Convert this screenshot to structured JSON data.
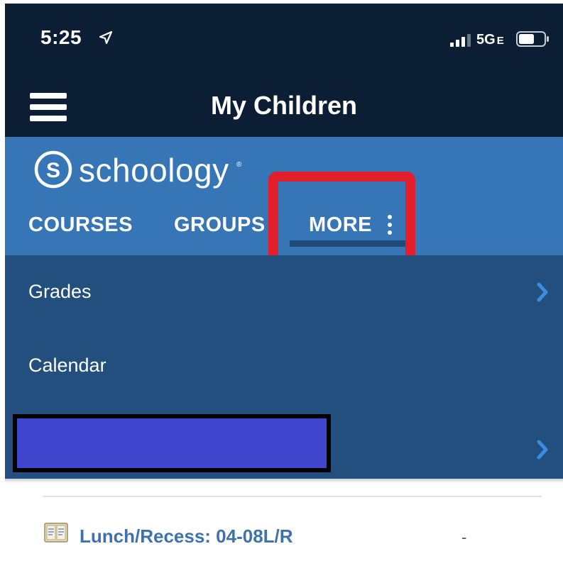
{
  "status_bar": {
    "time": "5:25",
    "network": "5G",
    "network_suffix": "E"
  },
  "title_bar": {
    "title": "My Children"
  },
  "brand": {
    "name": "schoology",
    "registered_mark": "®",
    "logo_letter": "S"
  },
  "tabs": [
    {
      "label": "COURSES"
    },
    {
      "label": "GROUPS"
    },
    {
      "label": "MORE"
    }
  ],
  "more_menu": {
    "items": [
      {
        "label": "Grades"
      },
      {
        "label": "Calendar"
      }
    ]
  },
  "course_list": [
    {
      "title": "Lunch/Recess: 04-08L/R",
      "grade": "-"
    }
  ],
  "colors": {
    "status_bg": "#0b1e33",
    "brand_blue": "#3776b6",
    "menu_bg": "#224f7d",
    "highlight_red": "#e21e2a",
    "redaction_blue": "#3f45cc",
    "link_blue": "#3f72ad"
  },
  "icons": {
    "location": "location-arrow-icon",
    "signal": "cellular-signal-icon",
    "battery": "battery-icon",
    "menu": "hamburger-menu-icon",
    "logo": "schoology-logo-icon",
    "more": "vertical-dots-icon",
    "chevron": "chevron-right-icon",
    "course": "course-book-icon"
  }
}
